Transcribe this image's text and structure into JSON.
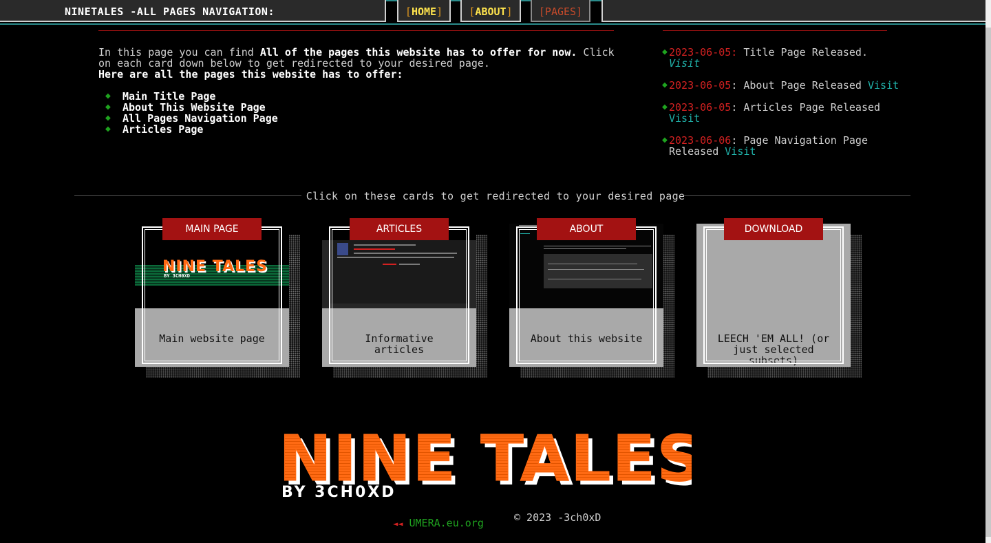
{
  "nav": {
    "title": "NINETALES -ALL PAGES NAVIGATION:",
    "buttons": [
      {
        "label": "HOME",
        "open": "[",
        "close": "]"
      },
      {
        "label": "ABOUT",
        "open": "[",
        "close": "]"
      },
      {
        "label": "PAGES",
        "open": "[",
        "close": "]"
      }
    ]
  },
  "intro": {
    "p1_a": "In this page you can find ",
    "p1_b": "All of the pages this website has to offer for now.",
    "p1_c": " Click on each card down below to get redirected to your desired page.",
    "p2": "Here are all the pages this website has to offer:",
    "list": [
      "Main Title Page",
      "About This Website Page",
      "All Pages Navigation Page",
      "Articles Page"
    ],
    "bullet": "◆"
  },
  "changelog": [
    {
      "date": "2023-06-05:",
      "text": " Title Page Released. ",
      "link": "Visit"
    },
    {
      "date": "2023-06-05",
      "text": ": About Page Released ",
      "link": "Visit"
    },
    {
      "date": "2023-06-05",
      "text": ": Articles Page Released ",
      "link": "Visit"
    },
    {
      "date": "2023-06-06",
      "text": ": Page Navigation Page Released ",
      "link": "Visit"
    }
  ],
  "divider_text": "Click on these cards to get redirected to your desired page",
  "cards": [
    {
      "tag": "MAIN PAGE",
      "caption": "Main website page"
    },
    {
      "tag": "ARTICLES",
      "caption": "Informative articles"
    },
    {
      "tag": "ABOUT",
      "caption": "About this website"
    },
    {
      "tag": "DOWNLOAD",
      "caption": "LEECH 'EM ALL! (or just selected subsets)"
    }
  ],
  "logo": {
    "title": "NINE TALES",
    "subtitle": "BY 3CH0XD"
  },
  "footer": {
    "copyright": "© 2023 -3ch0xD",
    "umera": "UMERA.eu.org",
    "umera_arrow": "◄◄"
  },
  "colors": {
    "accent_red": "#a31212",
    "link_teal": "#20b2aa",
    "bullet_green": "#1fa31f",
    "logo_orange": "#ff6a13",
    "nav_yellow": "#ffe44d"
  }
}
